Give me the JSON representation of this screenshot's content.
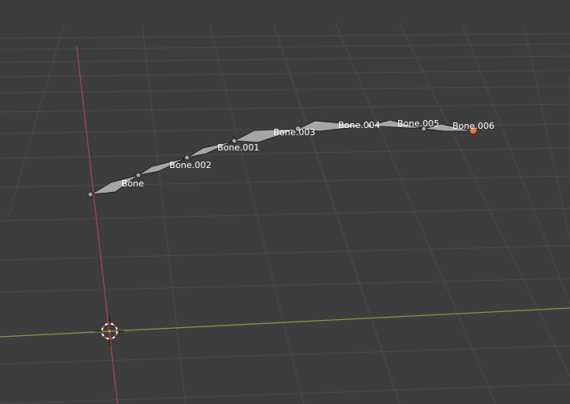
{
  "viewport": {
    "background": "#3d3d3d",
    "grid_color": "#4a4a4a",
    "x_axis_color": "#7d9a3a",
    "y_axis_color": "#a0454c",
    "bone_fill": "#a6a6a6",
    "bone_outline": "#202020",
    "selected_joint_color": "#e07a40"
  },
  "armature": {
    "bones": [
      {
        "name": "Bone"
      },
      {
        "name": "Bone.001"
      },
      {
        "name": "Bone.002"
      },
      {
        "name": "Bone.003"
      },
      {
        "name": "Bone.004"
      },
      {
        "name": "Bone.005"
      },
      {
        "name": "Bone.006"
      }
    ]
  },
  "cursor": {
    "icon": "3d-cursor-icon"
  }
}
